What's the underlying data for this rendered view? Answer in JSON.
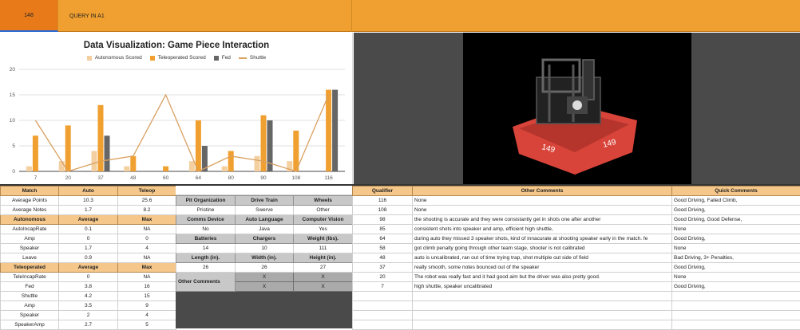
{
  "topbar": {
    "cell_ref": "148",
    "formula": "QUERY IN A1"
  },
  "chart_data": {
    "type": "bar",
    "title": "Data Visualization: Game Piece Interaction",
    "categories": [
      "7",
      "20",
      "37",
      "48",
      "60",
      "64",
      "80",
      "90",
      "108",
      "116"
    ],
    "series": [
      {
        "name": "Autonomous Scored",
        "color": "#f4cfa0",
        "values": [
          1,
          2,
          4,
          1,
          0,
          2,
          1,
          3,
          2,
          0
        ]
      },
      {
        "name": "Teleoperated Scored",
        "color": "#f0a030",
        "values": [
          7,
          9,
          13,
          3,
          1,
          10,
          4,
          11,
          8,
          16
        ]
      },
      {
        "name": "Fed",
        "color": "#666666",
        "values": [
          0,
          0,
          7,
          0,
          0,
          5,
          0,
          10,
          0,
          16
        ]
      },
      {
        "name": "Shuttle",
        "type": "line",
        "color": "#d9a060",
        "values": [
          10,
          0,
          2,
          3,
          15,
          0,
          3,
          2,
          0,
          15
        ]
      }
    ],
    "ylim": [
      0,
      20
    ],
    "yticks": [
      "0",
      "5",
      "10",
      "15",
      "20"
    ],
    "grid": true,
    "legend": "top"
  },
  "summary": {
    "header": [
      "Match",
      "Auto",
      "Teleop"
    ],
    "rows": [
      [
        "Average Points",
        "10.3",
        "25.6"
      ],
      [
        "Average Notes",
        "1.7",
        "8.2"
      ]
    ],
    "auto_header": [
      "Autonomous",
      "Average",
      "Max"
    ],
    "auto_rows": [
      [
        "AutoIncapRate",
        "0.1",
        "NA"
      ],
      [
        "Amp",
        "0",
        "0"
      ],
      [
        "Speaker",
        "1.7",
        "4"
      ],
      [
        "Leave",
        "0.9",
        "NA"
      ]
    ],
    "tele_header": [
      "Teleoperated",
      "Average",
      "Max"
    ],
    "tele_rows": [
      [
        "TeleIncapRate",
        "0",
        "NA"
      ],
      [
        "Fed",
        "3.8",
        "16"
      ],
      [
        "Shuttle",
        "4.2",
        "15"
      ],
      [
        "Amp",
        "3.5",
        "9"
      ],
      [
        "Speaker",
        "2",
        "4"
      ],
      [
        "SpeakerAmp",
        "2.7",
        "5"
      ]
    ]
  },
  "pit": {
    "r1": [
      "Pit Organization",
      "Drive Train",
      "Wheels"
    ],
    "r2": [
      "Pristine",
      "Swerve",
      "Other"
    ],
    "r3": [
      "Comms Device",
      "Auto Language",
      "Computer Vision"
    ],
    "r4": [
      "No",
      "Java",
      "Yes"
    ],
    "r5": [
      "Batteries",
      "Chargers",
      "Weight (lbs)."
    ],
    "r6": [
      "14",
      "10",
      "111"
    ],
    "r7": [
      "Length (in).",
      "Width (in).",
      "Height (in)."
    ],
    "r8": [
      "26",
      "26",
      "27"
    ],
    "other_label": "Other Comments",
    "x1": "X",
    "x2": "X",
    "x3": "X",
    "x4": "X"
  },
  "comments": {
    "header": [
      "Qualifier",
      "Other Comments",
      "Quick Comments"
    ],
    "rows": [
      [
        "116",
        "None",
        "Good Driving, Failed Climb,"
      ],
      [
        "108",
        "None",
        "Good Driving,"
      ],
      [
        "98",
        "the shooting is accurate  and they were consistantly get in shots one after another",
        "Good Driving, Good Defense,"
      ],
      [
        "85",
        "consistent shots into speaker and amp, efficient high shuttle,",
        "None"
      ],
      [
        "64",
        "during auto they missed 3 speaker shots, kind of innacurate at shooting speaker early in the match. fe",
        "Good Driving,"
      ],
      [
        "58",
        "got climb penalty going through other team stage, shooter is not calibrated",
        "None"
      ],
      [
        "48",
        "auto is uncalibrated, ran out of time trying trap, shot multiple out side of field",
        "Bad Driving, 3+ Penalties,"
      ],
      [
        "37",
        "really smooth, some notes bounced out of the speaker",
        "Good Driving,"
      ],
      [
        "20",
        "The robot was really fast and it had good aim but the driver was also pretty good.",
        "None"
      ],
      [
        "7",
        "high shuttle, speaker uncalibrated",
        "Good Driving,"
      ]
    ]
  }
}
